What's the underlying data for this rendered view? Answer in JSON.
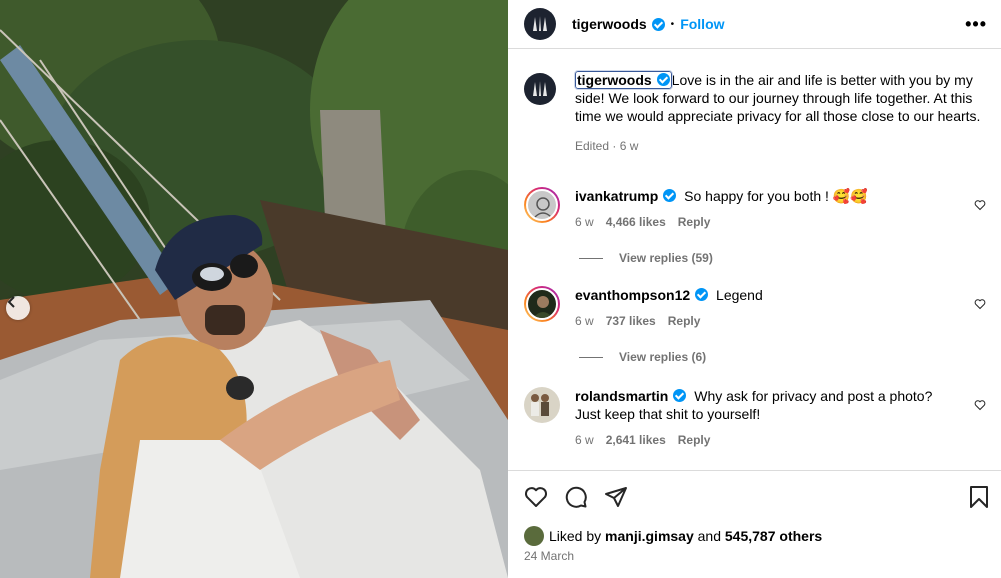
{
  "post": {
    "author": "tigerwoods",
    "follow_label": "Follow",
    "separator": "•",
    "more_label": "•••",
    "caption_text": "Love is in the air and life is better with you by my side! We look forward to our journey through life together. At this time we would appreciate privacy for all those close to our hearts.",
    "caption_meta": "Edited · 6 w"
  },
  "comments": [
    {
      "user": "ivankatrump",
      "text": "So happy for you both ! 🥰🥰",
      "age": "6 w",
      "likes": "4,466 likes",
      "reply": "Reply",
      "view_replies": "View replies (59)"
    },
    {
      "user": "evanthompson12",
      "text": "Legend",
      "age": "6 w",
      "likes": "737 likes",
      "reply": "Reply",
      "view_replies": "View replies (6)"
    },
    {
      "user": "rolandsmartin",
      "text": "Why ask for privacy and post a photo? Just keep that shit to yourself!",
      "age": "6 w",
      "likes": "2,641 likes",
      "reply": "Reply"
    }
  ],
  "footer": {
    "liked_by_prefix": "Liked by",
    "liked_by_user": "manji.gimsay",
    "liked_by_and": "and",
    "liked_by_count": "545,787 others",
    "date": "24 March"
  },
  "icons": {
    "carousel_prev": "chevron-left-icon",
    "like": "heart-icon",
    "comment": "comment-icon",
    "share": "send-icon",
    "save": "bookmark-icon",
    "verified": "verified-badge-icon",
    "more": "more-options-icon"
  },
  "colors": {
    "accent": "#0095f6",
    "muted": "#737373",
    "border": "#dbdbdb"
  }
}
